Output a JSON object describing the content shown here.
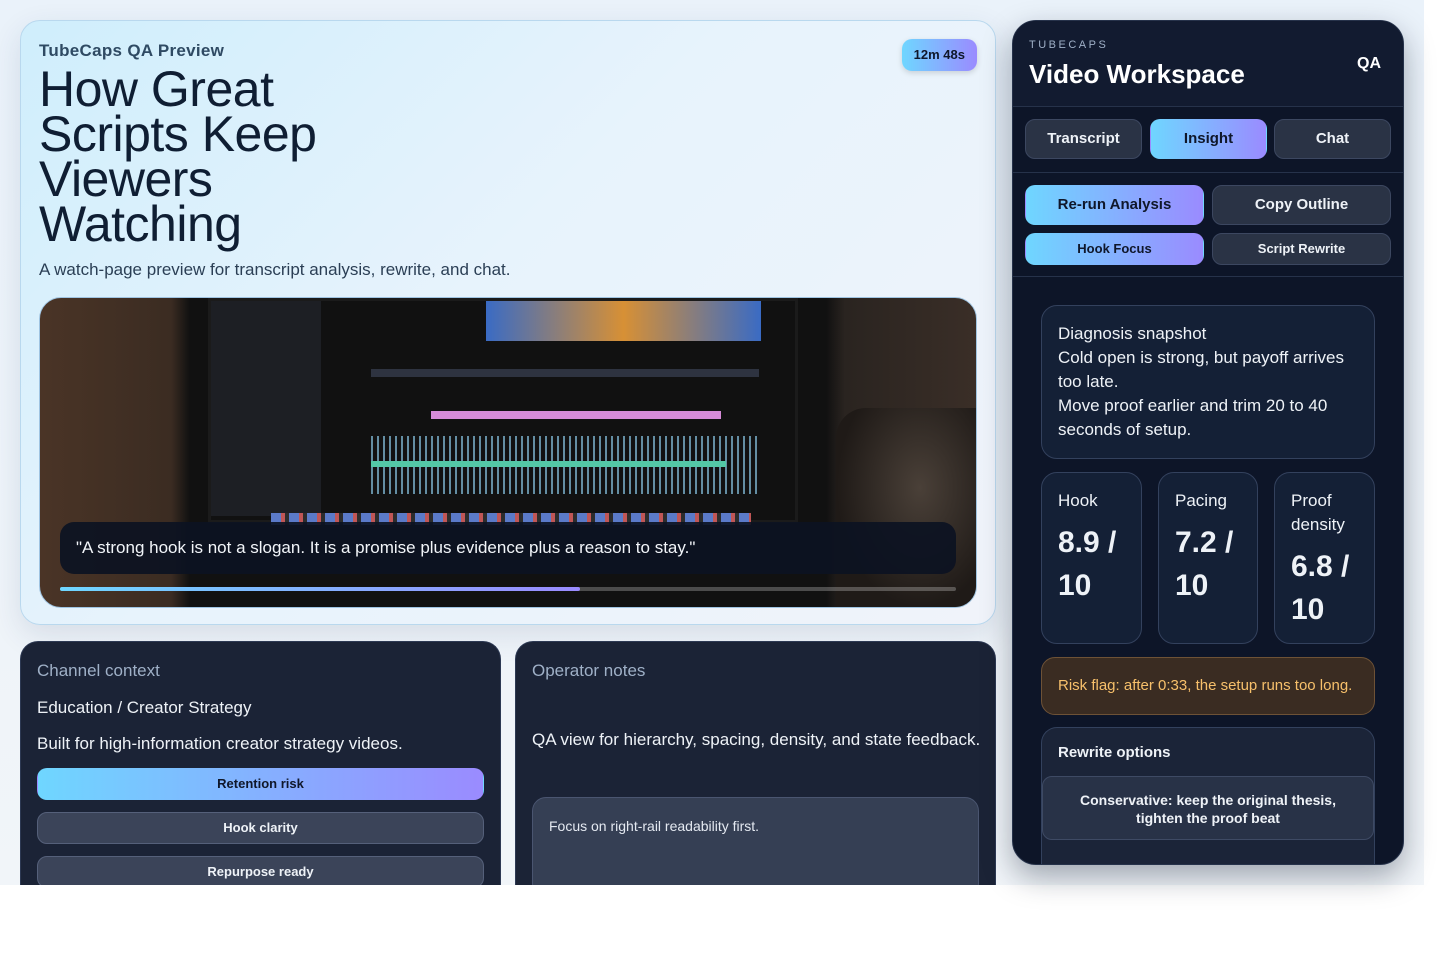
{
  "hero": {
    "eyebrow": "TubeCaps QA Preview",
    "duration": "12m 48s",
    "title": "How Great Scripts Keep Viewers Watching",
    "subtitle": "A watch-page preview for transcript analysis, rewrite, and chat.",
    "quote": "\"A strong hook is not a slogan. It is a promise plus evidence plus a reason to stay.\"",
    "progress_percent": 58
  },
  "channel": {
    "label": "Channel context",
    "category": "Education / Creator Strategy",
    "description": "Built for high-information creator strategy videos.",
    "pills": [
      {
        "label": "Retention risk",
        "active": true
      },
      {
        "label": "Hook clarity",
        "active": false
      },
      {
        "label": "Repurpose ready",
        "active": false
      }
    ]
  },
  "operator": {
    "label": "Operator notes",
    "description": "QA view for hierarchy, spacing, density, and state feedback.",
    "note": "Focus on right-rail readability first."
  },
  "rail": {
    "eyebrow": "TUBECAPS",
    "title": "Video Workspace",
    "mode": "QA",
    "tabs": [
      {
        "label": "Transcript",
        "active": false
      },
      {
        "label": "Insight",
        "active": true
      },
      {
        "label": "Chat",
        "active": false
      }
    ],
    "actions": {
      "rerun": "Re-run Analysis",
      "copy": "Copy Outline",
      "hook_focus": "Hook Focus",
      "script_rewrite": "Script Rewrite"
    },
    "diagnosis": {
      "title": "Diagnosis snapshot",
      "line1": "Cold open is strong, but payoff arrives too late.",
      "line2": "Move proof earlier and trim 20 to 40 seconds of setup."
    },
    "metrics": [
      {
        "label": "Hook",
        "value": "8.9 / 10"
      },
      {
        "label": "Pacing",
        "value": "7.2 / 10"
      },
      {
        "label": "Proof density",
        "value": "6.8 / 10"
      }
    ],
    "risk": "Risk flag: after 0:33, the setup runs too long.",
    "rewrite": {
      "title": "Rewrite options",
      "option1": "Conservative: keep the original thesis, tighten the proof beat"
    }
  }
}
